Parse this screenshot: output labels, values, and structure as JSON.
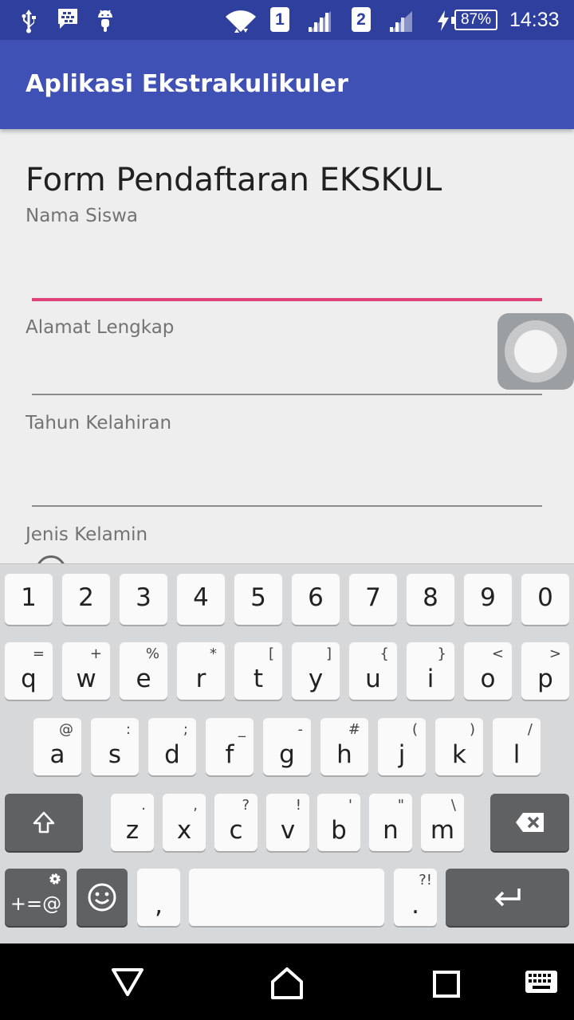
{
  "status_bar": {
    "icons": [
      "usb-icon",
      "bbm-icon",
      "android-icon",
      "wifi-icon",
      "signal-icon"
    ],
    "sim1": "1",
    "sim2": "2",
    "battery": "87%",
    "time": "14:33"
  },
  "app_bar": {
    "title": "Aplikasi Ekstrakulikuler"
  },
  "form": {
    "title": "Form Pendaftaran EKSKUL",
    "fields": [
      {
        "label": "Nama Siswa",
        "value": ""
      },
      {
        "label": "Alamat Lengkap",
        "value": ""
      },
      {
        "label": "Tahun Kelahiran",
        "value": ""
      },
      {
        "label": "Jenis Kelamin"
      }
    ]
  },
  "keyboard": {
    "number_row": [
      "1",
      "2",
      "3",
      "4",
      "5",
      "6",
      "7",
      "8",
      "9",
      "0"
    ],
    "row1": [
      {
        "key": "q",
        "sub": "="
      },
      {
        "key": "w",
        "sub": "+"
      },
      {
        "key": "e",
        "sub": "%"
      },
      {
        "key": "r",
        "sub": "*"
      },
      {
        "key": "t",
        "sub": "["
      },
      {
        "key": "y",
        "sub": "]"
      },
      {
        "key": "u",
        "sub": "{"
      },
      {
        "key": "i",
        "sub": "}"
      },
      {
        "key": "o",
        "sub": "<"
      },
      {
        "key": "p",
        "sub": ">"
      }
    ],
    "row2": [
      {
        "key": "a",
        "sub": "@"
      },
      {
        "key": "s",
        "sub": ":"
      },
      {
        "key": "d",
        "sub": ";"
      },
      {
        "key": "f",
        "sub": "_"
      },
      {
        "key": "g",
        "sub": "-"
      },
      {
        "key": "h",
        "sub": "#"
      },
      {
        "key": "j",
        "sub": "("
      },
      {
        "key": "k",
        "sub": ")"
      },
      {
        "key": "l",
        "sub": "/"
      }
    ],
    "row3": [
      {
        "key": "z",
        "sub": "."
      },
      {
        "key": "x",
        "sub": ","
      },
      {
        "key": "c",
        "sub": "?"
      },
      {
        "key": "v",
        "sub": "!"
      },
      {
        "key": "b",
        "sub": "'"
      },
      {
        "key": "n",
        "sub": "\""
      },
      {
        "key": "m",
        "sub": "\\"
      }
    ],
    "symbols_label": "+=@",
    "comma": ",",
    "period": ".",
    "period_sub": "?!",
    "icons": {
      "shift": "shift-icon",
      "backspace": "backspace-icon",
      "settings": "gear-icon",
      "emoji": "emoji-icon",
      "enter": "enter-icon"
    }
  },
  "nav_bar": {
    "icons": [
      "back-icon",
      "home-icon",
      "recents-icon",
      "keyboard-icon"
    ]
  }
}
